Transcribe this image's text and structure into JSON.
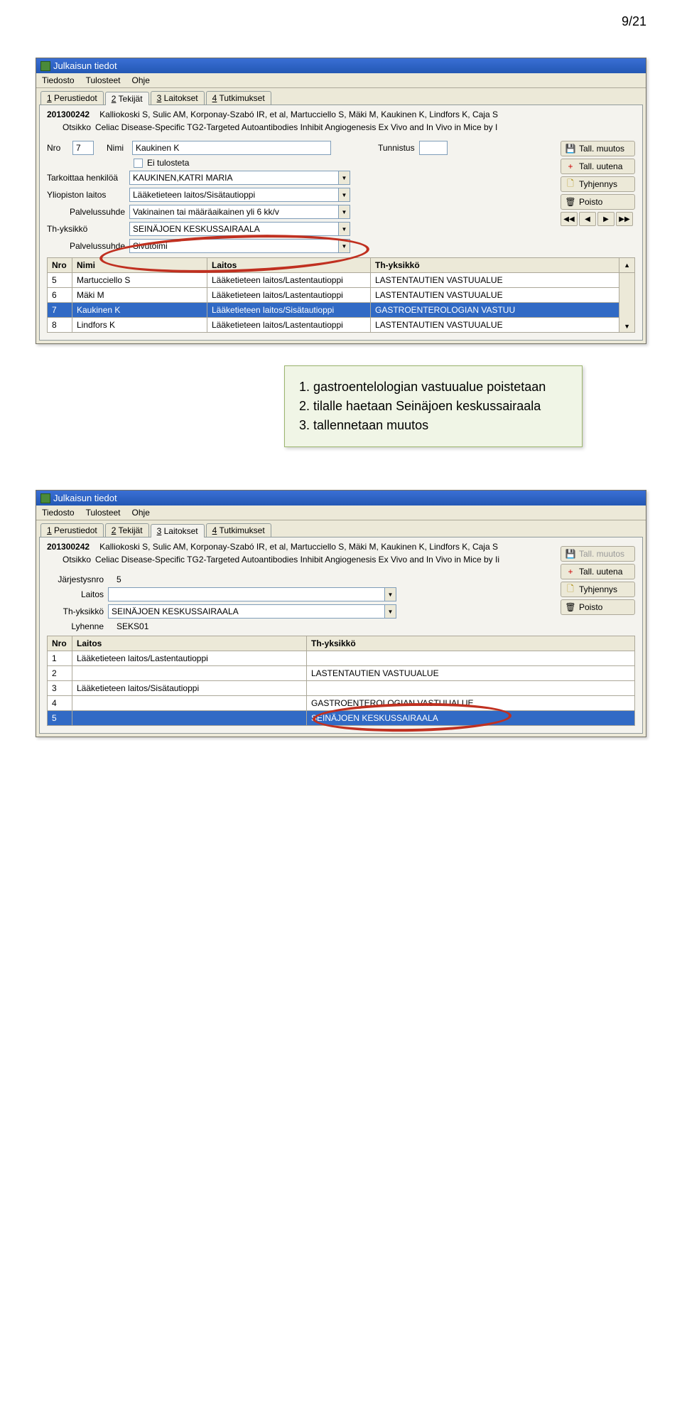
{
  "page_number": "9/21",
  "screenshot1": {
    "window_title": "Julkaisun tiedot",
    "menu": [
      "Tiedosto",
      "Tulosteet",
      "Ohje"
    ],
    "tabs": [
      {
        "key": "1",
        "label": "Perustiedot"
      },
      {
        "key": "2",
        "label": "Tekijät"
      },
      {
        "key": "3",
        "label": "Laitokset"
      },
      {
        "key": "4",
        "label": "Tutkimukset"
      }
    ],
    "active_tab": 1,
    "pub_id": "201300242",
    "authors_line": "Kalliokoski S, Sulic AM, Korponay-Szabó IR, et al, Martucciello S, Mäki M, Kaukinen K, Lindfors K, Caja S",
    "otsikko_label": "Otsikko",
    "otsikko": "Celiac Disease-Specific TG2-Targeted Autoantibodies Inhibit Angiogenesis Ex Vivo and In Vivo in Mice by I",
    "form": {
      "nro_lbl": "Nro",
      "nro": "7",
      "nimi_lbl": "Nimi",
      "nimi": "Kaukinen K",
      "ei_tulosteta": "Ei tulosteta",
      "tunnistus_lbl": "Tunnistus",
      "tark_lbl": "Tarkoittaa henkilöä",
      "tark": "KAUKINEN,KATRI MARIA",
      "yl_lbl": "Yliopiston laitos",
      "yl": "Lääketieteen laitos/Sisätautioppi",
      "palv_lbl": "Palvelussuhde",
      "palv": "Vakinainen tai määräaikainen yli 6 kk/v",
      "th_lbl": "Th-yksikkö",
      "th": "SEINÄJOEN KESKUSSAIRAALA",
      "palv2_lbl": "Palvelussuhde",
      "palv2": "Sivutoimi"
    },
    "buttons": {
      "tall_muutos": "Tall. muutos",
      "tall_uutena": "Tall. uutena",
      "tyhjennys": "Tyhjennys",
      "poisto": "Poisto"
    },
    "table": {
      "headers": [
        "Nro",
        "Nimi",
        "Laitos",
        "Th-yksikkö"
      ],
      "rows": [
        {
          "nro": "5",
          "nimi": "Martucciello S",
          "laitos": "Lääketieteen laitos/Lastentautioppi",
          "th": "LASTENTAUTIEN VASTUUALUE"
        },
        {
          "nro": "6",
          "nimi": "Mäki M",
          "laitos": "Lääketieteen laitos/Lastentautioppi",
          "th": "LASTENTAUTIEN VASTUUALUE"
        },
        {
          "nro": "7",
          "nimi": "Kaukinen K",
          "laitos": "Lääketieteen laitos/Sisätautioppi",
          "th": "GASTROENTEROLOGIAN VASTUU"
        },
        {
          "nro": "8",
          "nimi": "Lindfors K",
          "laitos": "Lääketieteen laitos/Lastentautioppi",
          "th": "LASTENTAUTIEN VASTUUALUE"
        }
      ],
      "selected": 2
    }
  },
  "annotation": {
    "line1": "1. gastroentelologian vastuualue poistetaan",
    "line2": "2. tilalle haetaan Seinäjoen keskussairaala",
    "line3": "3. tallennetaan muutos"
  },
  "screenshot2": {
    "window_title": "Julkaisun tiedot",
    "menu": [
      "Tiedosto",
      "Tulosteet",
      "Ohje"
    ],
    "tabs": [
      {
        "key": "1",
        "label": "Perustiedot"
      },
      {
        "key": "2",
        "label": "Tekijät"
      },
      {
        "key": "3",
        "label": "Laitokset"
      },
      {
        "key": "4",
        "label": "Tutkimukset"
      }
    ],
    "active_tab": 2,
    "pub_id": "201300242",
    "authors_line": "Kalliokoski S, Sulic AM, Korponay-Szabó IR, et al, Martucciello S, Mäki M, Kaukinen K, Lindfors K, Caja S",
    "otsikko_label": "Otsikko",
    "otsikko": "Celiac Disease-Specific TG2-Targeted Autoantibodies Inhibit Angiogenesis Ex Vivo and In Vivo in Mice by Ii",
    "form": {
      "jarj_lbl": "Järjestysnro",
      "jarj": "5",
      "laitos_lbl": "Laitos",
      "laitos": "",
      "th_lbl": "Th-yksikkö",
      "th": "SEINÄJOEN KESKUSSAIRAALA",
      "lyh_lbl": "Lyhenne",
      "lyh": "SEKS01"
    },
    "buttons": {
      "tall_muutos": "Tall. muutos",
      "tall_uutena": "Tall. uutena",
      "tyhjennys": "Tyhjennys",
      "poisto": "Poisto"
    },
    "table": {
      "headers": [
        "Nro",
        "Laitos",
        "Th-yksikkö"
      ],
      "rows": [
        {
          "nro": "1",
          "laitos": "Lääketieteen laitos/Lastentautioppi",
          "th": ""
        },
        {
          "nro": "2",
          "laitos": "",
          "th": "LASTENTAUTIEN VASTUUALUE"
        },
        {
          "nro": "3",
          "laitos": "Lääketieteen laitos/Sisätautioppi",
          "th": ""
        },
        {
          "nro": "4",
          "laitos": "",
          "th": "GASTROENTEROLOGIAN VASTUUALUE"
        },
        {
          "nro": "5",
          "laitos": "",
          "th": "SEINÄJOEN KESKUSSAIRAALA"
        }
      ],
      "selected": 4
    }
  }
}
